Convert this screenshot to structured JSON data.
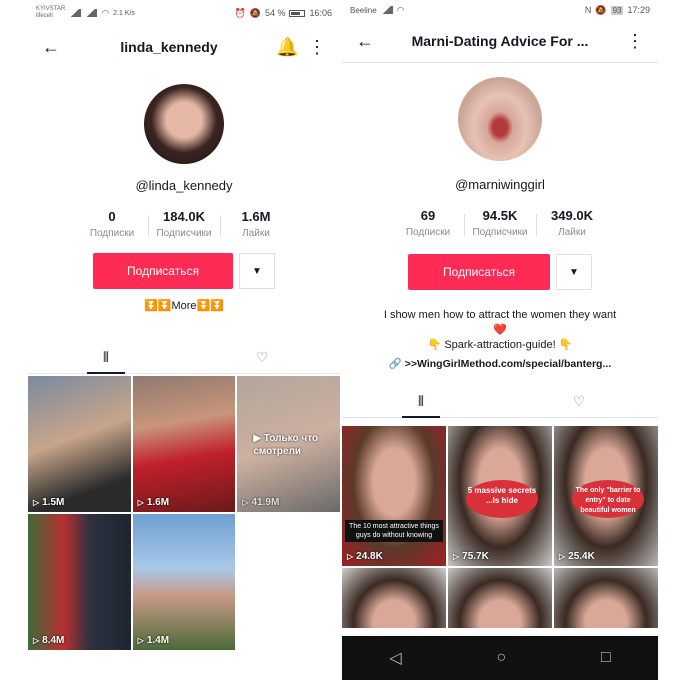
{
  "left": {
    "status": {
      "carrier1": "KYIVSTAR",
      "carrier2": "lifecell",
      "speed": "2.1 K/s",
      "battery": "54 %",
      "time": "16:06"
    },
    "nav": {
      "title": "linda_kennedy",
      "back_icon": "arrow-left-icon",
      "bell_icon": "bell-icon",
      "more_icon": "more-vertical-icon"
    },
    "handle": "@linda_kennedy",
    "stats": [
      {
        "value": "0",
        "label": "Подписки"
      },
      {
        "value": "184.0K",
        "label": "Подписчики"
      },
      {
        "value": "1.6M",
        "label": "Лайки"
      }
    ],
    "follow_label": "Подписаться",
    "bio": "⏬⏬More⏬⏬",
    "tabs": [
      "videos-grid-icon",
      "liked-hidden-icon"
    ],
    "videos": [
      {
        "views": "1.5M",
        "overlay": ""
      },
      {
        "views": "1.6M",
        "overlay": ""
      },
      {
        "views": "41.9M",
        "overlay": "▶ Только что смотрели"
      },
      {
        "views": "8.4M",
        "overlay": ""
      },
      {
        "views": "1.4M",
        "overlay": ""
      }
    ]
  },
  "right": {
    "status": {
      "carrier": "Beeline",
      "battery": "93",
      "time": "17:29"
    },
    "nav": {
      "title": "Marni-Dating Advice For ...",
      "back_icon": "arrow-left-icon",
      "more_icon": "more-vertical-icon"
    },
    "handle": "@marniwinggirl",
    "stats": [
      {
        "value": "69",
        "label": "Подписки"
      },
      {
        "value": "94.5K",
        "label": "Подписчики"
      },
      {
        "value": "349.0K",
        "label": "Лайки"
      }
    ],
    "follow_label": "Подписаться",
    "bio_line1": "I show men how to attract the women they want ❤️",
    "bio_line2": "👇 Spark-attraction-guide! 👇",
    "link": ">>WingGirlMethod.com/special/banterg...",
    "videos": [
      {
        "views": "24.8K",
        "caption": "The 10 most attractive things guys do without knowing"
      },
      {
        "views": "75.7K",
        "badge": "5 massive secrets ...ls hide"
      },
      {
        "views": "25.4K",
        "badge": "The only \"barrier to entry\" to date beautiful women"
      },
      {
        "views": "",
        "caption": ""
      },
      {
        "views": "",
        "caption": ""
      },
      {
        "views": "",
        "caption": ""
      }
    ],
    "android_nav": [
      "◁",
      "○",
      "□"
    ]
  }
}
